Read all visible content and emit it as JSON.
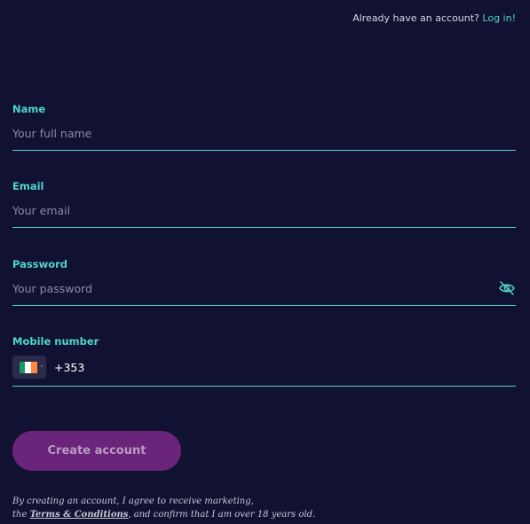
{
  "header": {
    "already_text": "Already have an account?",
    "login_link": "Log in!"
  },
  "form": {
    "name": {
      "label": "Name",
      "placeholder": "Your full name"
    },
    "email": {
      "label": "Email",
      "placeholder": "Your email"
    },
    "password": {
      "label": "Password",
      "placeholder": "Your password",
      "toggle_icon": "eye-slash-icon"
    },
    "mobile": {
      "label": "Mobile number",
      "country_flag": "ireland-flag",
      "dial_code": "+353"
    },
    "submit_label": "Create account"
  },
  "legal": {
    "line1": "By creating an account, I agree to receive marketing,",
    "line2_prefix": "the",
    "terms_link": "Terms & Conditions",
    "line2_suffix": ", and confirm that I am over 18 years old."
  },
  "colors": {
    "background": "#111132",
    "accent": "#4fd6cc",
    "button": "#6a2479"
  }
}
